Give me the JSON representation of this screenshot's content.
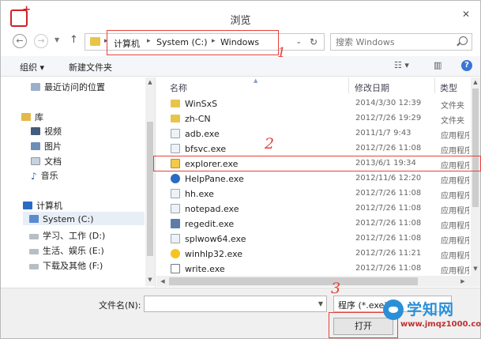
{
  "window": {
    "title": "浏览"
  },
  "address_bar": {
    "crumbs": [
      "计算机",
      "System (C:)",
      "Windows"
    ],
    "separator": "▸"
  },
  "search": {
    "placeholder": "搜索 Windows"
  },
  "toolbar": {
    "organize": "组织 ▾",
    "new_folder": "新建文件夹",
    "view_icon": "☷ ▾",
    "pane_icon": "▥",
    "help": "?"
  },
  "nav": {
    "items": [
      {
        "label": "最近访问的位置"
      },
      {
        "label": "库"
      },
      {
        "label": "视频"
      },
      {
        "label": "图片"
      },
      {
        "label": "文档"
      },
      {
        "label": "音乐"
      },
      {
        "label": "计算机"
      },
      {
        "label": "System (C:)"
      },
      {
        "label": "学习、工作 (D:)"
      },
      {
        "label": "生活、娱乐 (E:)"
      },
      {
        "label": "下载及其他 (F:)"
      }
    ]
  },
  "columns": {
    "name": "名称",
    "date": "修改日期",
    "type": "类型"
  },
  "files": [
    {
      "name": "WinSxS",
      "date": "2014/3/30 12:39",
      "type": "文件夹"
    },
    {
      "name": "zh-CN",
      "date": "2012/7/26 19:29",
      "type": "文件夹"
    },
    {
      "name": "adb.exe",
      "date": "2011/1/7 9:43",
      "type": "应用程序"
    },
    {
      "name": "bfsvc.exe",
      "date": "2012/7/26 11:08",
      "type": "应用程序"
    },
    {
      "name": "explorer.exe",
      "date": "2013/6/1 19:34",
      "type": "应用程序"
    },
    {
      "name": "HelpPane.exe",
      "date": "2012/11/6 12:20",
      "type": "应用程序"
    },
    {
      "name": "hh.exe",
      "date": "2012/7/26 11:08",
      "type": "应用程序"
    },
    {
      "name": "notepad.exe",
      "date": "2012/7/26 11:08",
      "type": "应用程序"
    },
    {
      "name": "regedit.exe",
      "date": "2012/7/26 11:08",
      "type": "应用程序"
    },
    {
      "name": "splwow64.exe",
      "date": "2012/7/26 11:08",
      "type": "应用程序"
    },
    {
      "name": "winhlp32.exe",
      "date": "2012/7/26 11:21",
      "type": "应用程序"
    },
    {
      "name": "write.exe",
      "date": "2012/7/26 11:08",
      "type": "应用程序"
    }
  ],
  "bottom": {
    "filename_label": "文件名(N):",
    "filename_value": "",
    "filter": "程序 (*.exe)",
    "open_button": "打开"
  },
  "annotations": {
    "m1": "1",
    "m2": "2",
    "m3": "3"
  },
  "watermark": {
    "title": "学知网",
    "url": "www.jmqz1000.com"
  },
  "colors": {
    "accent": "#e8403a",
    "brand": "#2b8fd8"
  }
}
